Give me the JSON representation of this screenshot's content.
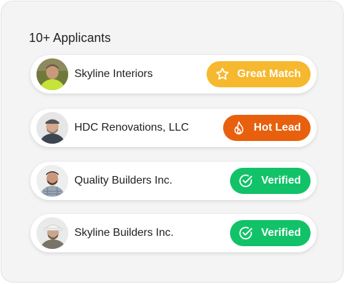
{
  "heading": "10+ Applicants",
  "applicants": [
    {
      "company": "Skyline Interiors",
      "badge": {
        "label": "Great Match",
        "icon": "star-icon",
        "color": "#f5b82e"
      }
    },
    {
      "company": "HDC Renovations, LLC",
      "badge": {
        "label": "Hot Lead",
        "icon": "flame-icon",
        "color": "#e8600d"
      }
    },
    {
      "company": "Quality Builders Inc.",
      "badge": {
        "label": "Verified",
        "icon": "check-circle-icon",
        "color": "#12c268"
      }
    },
    {
      "company": "Skyline Builders Inc.",
      "badge": {
        "label": "Verified",
        "icon": "check-circle-icon",
        "color": "#12c268"
      }
    }
  ]
}
